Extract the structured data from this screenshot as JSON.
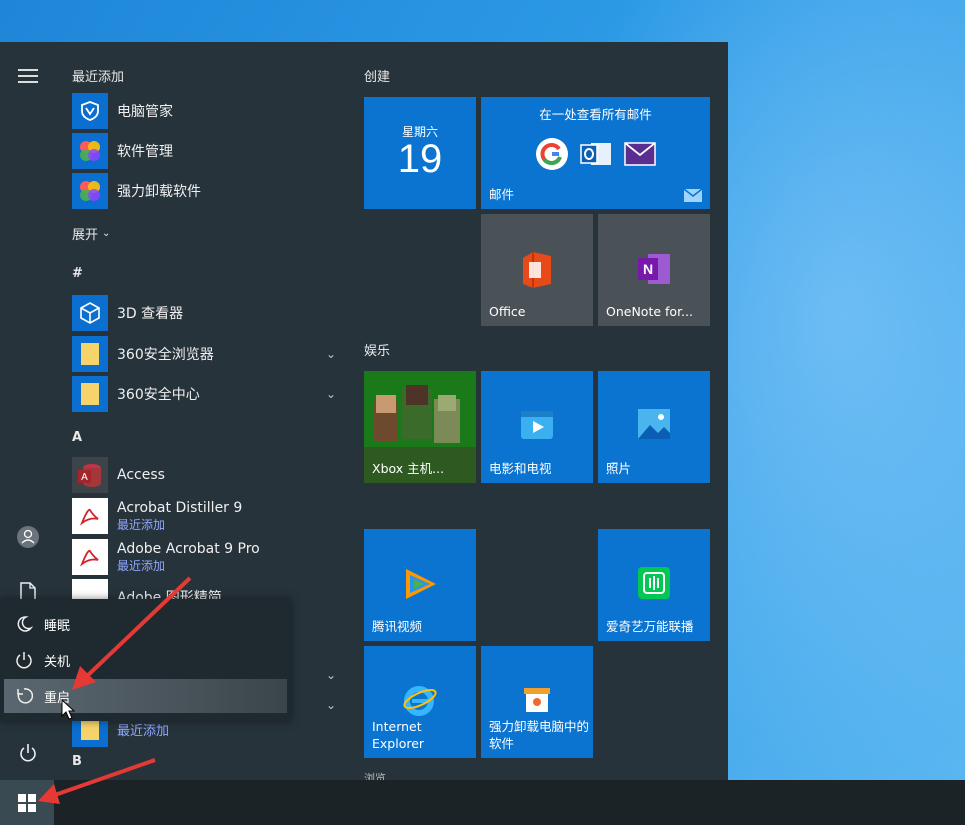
{
  "start_menu": {
    "recent_header": "最近添加",
    "expand_label": "展开",
    "recent_apps": [
      {
        "name": "电脑管家",
        "icon": "shield-v-icon"
      },
      {
        "name": "软件管理",
        "icon": "colorful-blocks-icon"
      },
      {
        "name": "强力卸载软件",
        "icon": "colorful-blocks-icon"
      }
    ],
    "groups": {
      "hash": "#",
      "a": "A",
      "b": "B"
    },
    "apps_hash": [
      {
        "name": "3D 查看器",
        "icon": "cube-icon"
      },
      {
        "name": "360安全浏览器",
        "icon": "folder-icon"
      },
      {
        "name": "360安全中心",
        "icon": "folder-icon"
      }
    ],
    "apps_a": [
      {
        "name": "Access",
        "icon": "access-icon"
      },
      {
        "name": "Acrobat Distiller 9",
        "sub": "最近添加",
        "icon": "pdf-icon"
      },
      {
        "name": "Adobe Acrobat 9 Pro",
        "sub": "最近添加",
        "icon": "pdf-icon"
      },
      {
        "name": "Adobe 图形精简",
        "icon": "file-icon"
      },
      {
        "sub": "最近添加",
        "icon": "folder-icon"
      }
    ]
  },
  "power_menu": {
    "items": [
      {
        "label": "睡眠",
        "icon": "moon-icon"
      },
      {
        "label": "关机",
        "icon": "power-icon"
      },
      {
        "label": "重启",
        "icon": "restart-icon"
      }
    ]
  },
  "tiles": {
    "section_create": "创建",
    "section_entertainment": "娱乐",
    "section_more": "浏览",
    "calendar": {
      "day_name": "星期六",
      "day_number": "19"
    },
    "mail": {
      "header": "在一处查看所有邮件",
      "label": "邮件"
    },
    "office": {
      "label": "Office"
    },
    "onenote": {
      "label": "OneNote for..."
    },
    "xbox": {
      "label": "Xbox 主机..."
    },
    "movies": {
      "label": "电影和电视"
    },
    "photos": {
      "label": "照片"
    },
    "tencent_video": {
      "label": "腾讯视频"
    },
    "iqiyi": {
      "label": "爱奇艺万能联播"
    },
    "ie": {
      "label": "Internet Explorer"
    },
    "uninstall": {
      "label": "强力卸载电脑中的软件"
    }
  },
  "colors": {
    "menu_bg": "#27333b",
    "tile_blue": "#0b74d1",
    "tile_gray": "#4a5257",
    "desktop": "#1e86d8",
    "arrow_red": "#e53935"
  }
}
